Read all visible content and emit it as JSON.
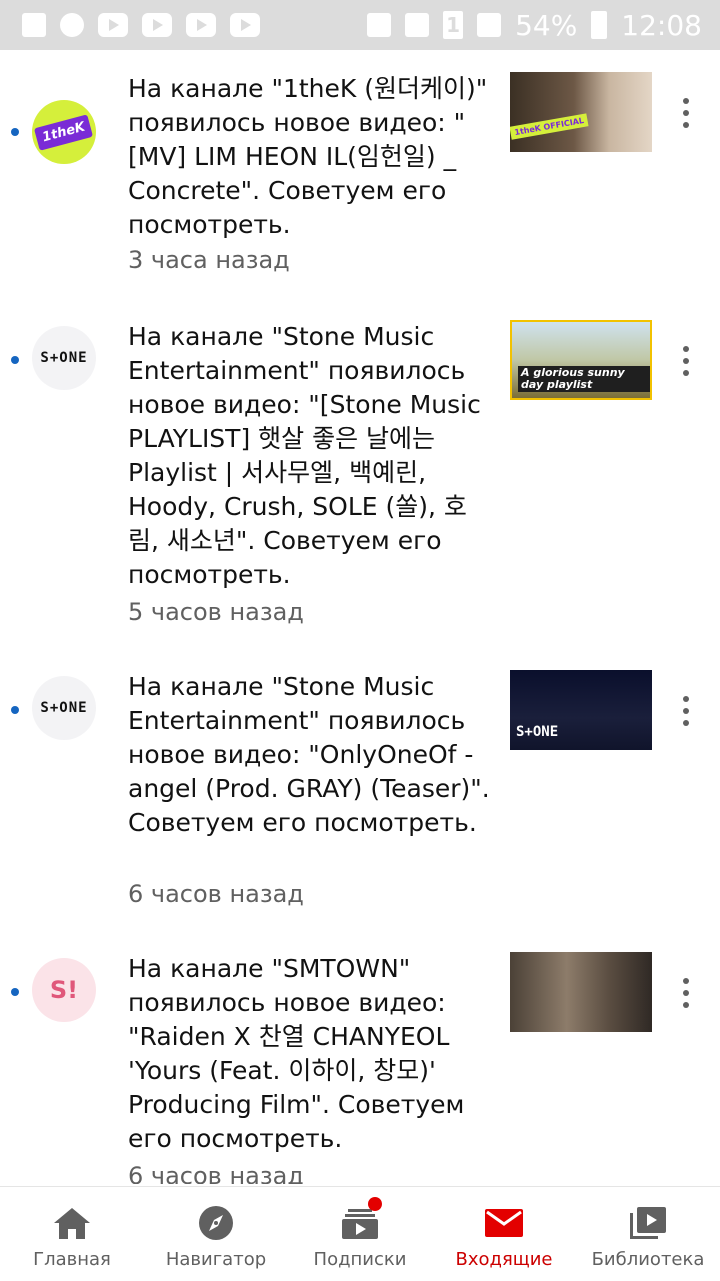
{
  "status_bar": {
    "battery": "54%",
    "time": "12:08",
    "sim": "1",
    "left_icons": [
      "photo-icon",
      "gear-icon",
      "youtube-icon",
      "youtube-icon",
      "youtube-icon",
      "youtube-icon"
    ],
    "right_icons": [
      "mute-icon",
      "wifi-icon",
      "sim-icon",
      "signal-icon",
      "battery-icon"
    ]
  },
  "notifications": [
    {
      "channel": "1theK (원더케이)",
      "avatar_text": "1theK",
      "text": "На канале \"1theK (원더케이)\" появилось новое видео: \"[MV] LIM HEON IL(임헌일) _ Concrete\". Советуем его посмотреть.",
      "time": "3 часа назад",
      "thumb_badge": "1theK OFFICIAL"
    },
    {
      "channel": "Stone Music Entertainment",
      "avatar_text": "S+ONE",
      "text": "На канале \"Stone Music Entertainment\" появилось новое видео: \"[Stone Music PLAYLIST] 햇살 좋은 날에는 Playlist | 서사무엘, 백예린, Hoody, Crush, SOLE (쏠), 호림, 새소년\". Советуем его посмотреть.",
      "time": "5 часов назад",
      "thumb_caption": "A glorious sunny day playlist"
    },
    {
      "channel": "Stone Music Entertainment",
      "avatar_text": "S+ONE",
      "text": "На канале \"Stone Music Entertainment\" появилось новое видео: \"OnlyOneOf - angel (Prod. GRAY) (Teaser)\". Советуем его посмотреть.",
      "time": "6 часов назад",
      "thumb_caption": "S+ONE"
    },
    {
      "channel": "SMTOWN",
      "avatar_text": "S!",
      "text": "На канале \"SMTOWN\" появилось новое видео: \"Raiden X 찬열 CHANYEOL 'Yours (Feat. 이하이, 창모)' Producing Film\". Советуем его посмотреть.",
      "time": "6 часов назад"
    }
  ],
  "bottom_nav": {
    "items": [
      {
        "label": "Главная",
        "icon": "home-icon"
      },
      {
        "label": "Навигатор",
        "icon": "explore-icon"
      },
      {
        "label": "Подписки",
        "icon": "subscriptions-icon"
      },
      {
        "label": "Входящие",
        "icon": "inbox-icon",
        "active": true
      },
      {
        "label": "Библиотека",
        "icon": "library-icon"
      }
    ],
    "active_color": "#cc0000",
    "badge_color": "#e30000"
  }
}
